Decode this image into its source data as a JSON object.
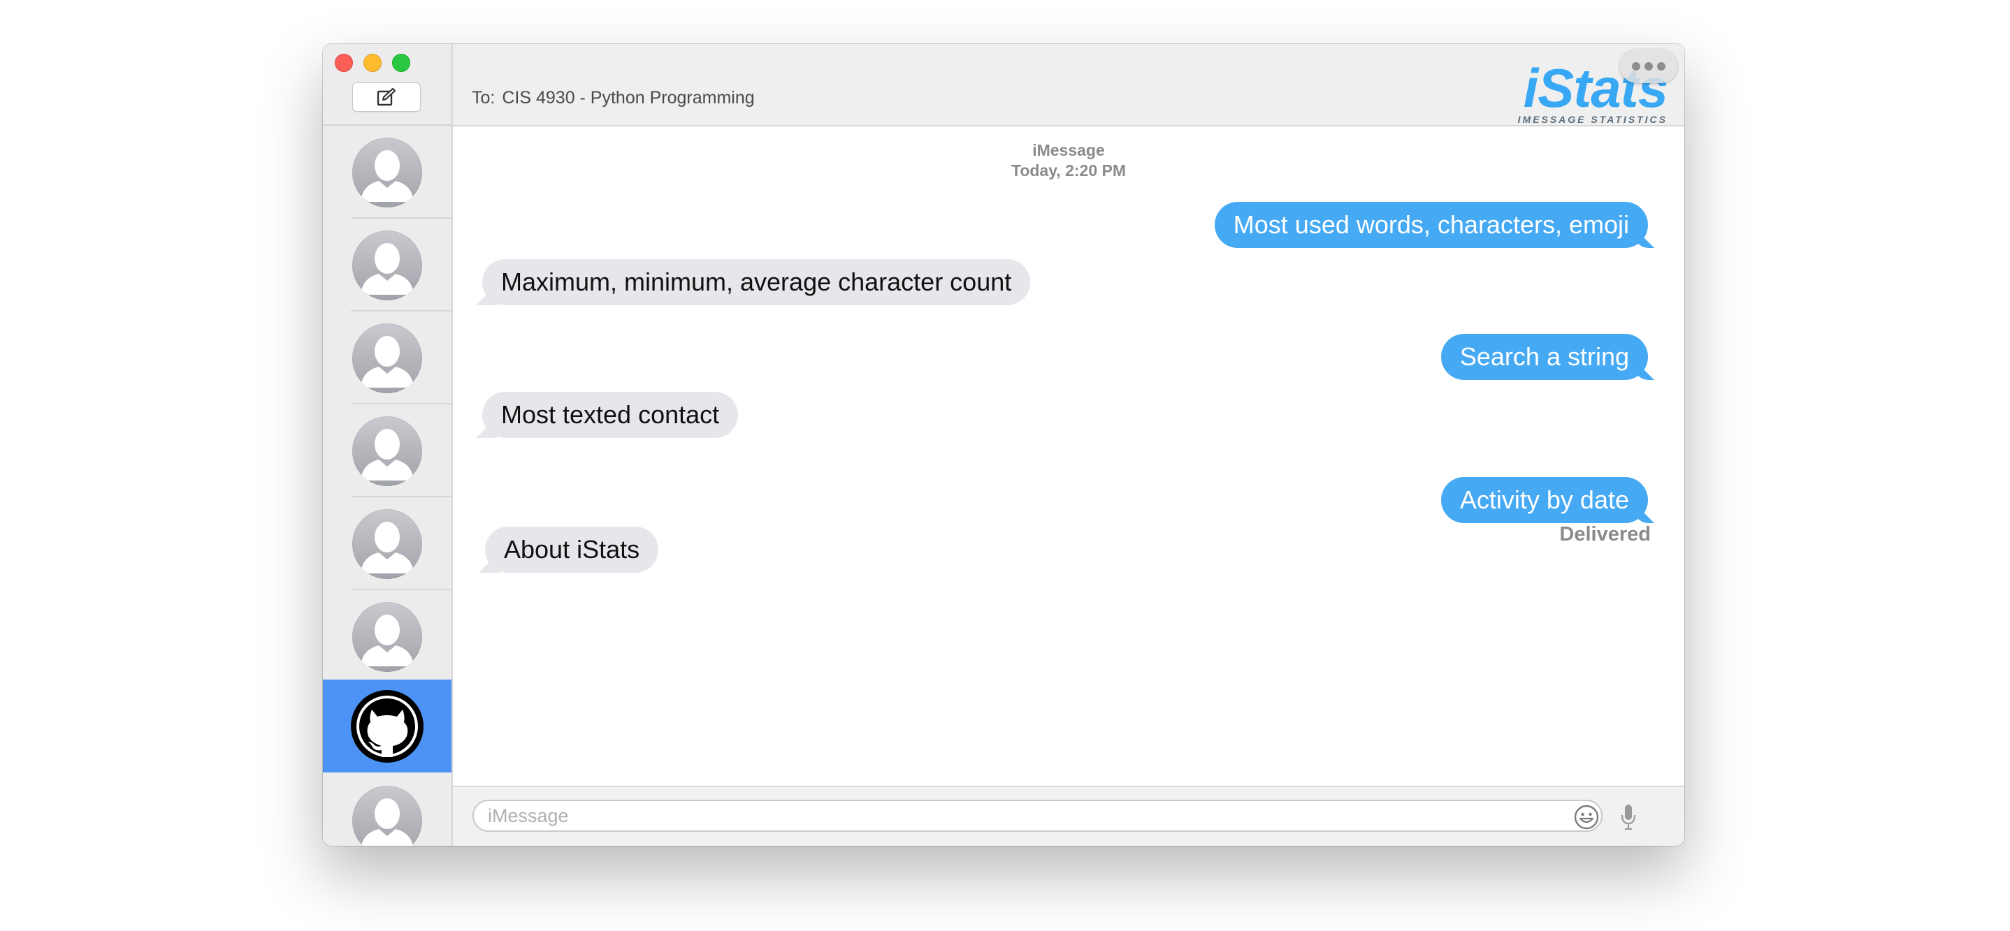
{
  "window": {
    "controls": {
      "close": "close-button",
      "minimize": "minimize-button",
      "zoom": "zoom-button"
    }
  },
  "sidebar": {
    "compose_icon": "compose-icon",
    "contacts": [
      {
        "name": "contact-1",
        "avatar": "person-placeholder"
      },
      {
        "name": "contact-2",
        "avatar": "person-placeholder"
      },
      {
        "name": "contact-3",
        "avatar": "person-placeholder"
      },
      {
        "name": "contact-4",
        "avatar": "person-placeholder"
      },
      {
        "name": "contact-5",
        "avatar": "person-placeholder"
      },
      {
        "name": "contact-6",
        "avatar": "person-placeholder"
      },
      {
        "name": "contact-7",
        "avatar": "github-octocat",
        "selected": true
      },
      {
        "name": "contact-8",
        "avatar": "person-placeholder"
      }
    ],
    "selected_color": "#4c93f5"
  },
  "header": {
    "to_prefix": "To:",
    "recipient": "CIS 4930 - Python Programming",
    "logo_title": "iStats",
    "logo_subtitle": "IMESSAGE STATISTICS",
    "more_icon": "more-dots-icon"
  },
  "conversation": {
    "service": "iMessage",
    "timestamp": "Today, 2:20 PM",
    "messages": [
      {
        "direction": "outgoing",
        "text": "Most used words, characters, emoji"
      },
      {
        "direction": "incoming",
        "text": "Maximum, minimum, average character count"
      },
      {
        "direction": "outgoing",
        "text": "Search a string"
      },
      {
        "direction": "incoming",
        "text": "Most texted contact"
      },
      {
        "direction": "outgoing",
        "text": "Activity by date"
      },
      {
        "direction": "incoming",
        "text": "About iStats"
      }
    ],
    "status": "Delivered",
    "outgoing_color": "#46a9f4",
    "incoming_color": "#e6e6eb"
  },
  "input": {
    "placeholder": "iMessage",
    "value": "",
    "emoji_icon": "emoji-icon",
    "mic_icon": "microphone-icon"
  }
}
